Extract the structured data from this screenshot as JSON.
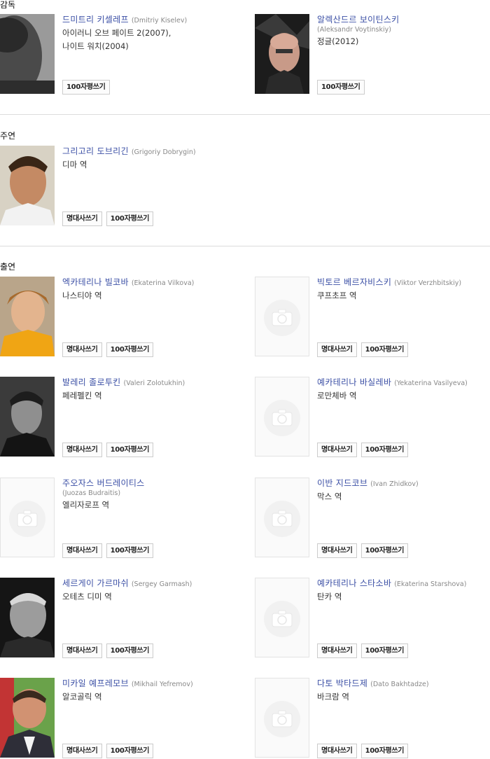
{
  "sections": {
    "director": "감독",
    "lead": "주연",
    "cast": "출연"
  },
  "buttons": {
    "quote": "명대사쓰기",
    "review": "100자평쓰기"
  },
  "directors": [
    {
      "name_ko": "드미트리 키셀레프",
      "name_en": "(Dmitriy Kiselev)",
      "desc": [
        "아이러니 오브 페이트 2(2007),",
        "나이트 워치(2004)"
      ]
    },
    {
      "name_ko": "알렉산드르 보이틴스키",
      "name_en": "(Aleksandr Voytinskiy)",
      "desc": [
        "정글(2012)"
      ]
    }
  ],
  "leads": [
    {
      "name_ko": "그리고리 도브리긴",
      "name_en": "(Grigoriy Dobrygin)",
      "role": "디마 역"
    }
  ],
  "cast": [
    {
      "name_ko": "엑카테리나 빌코바",
      "name_en": "(Ekaterina Vilkova)",
      "role": "나스티야 역"
    },
    {
      "name_ko": "빅토르 베르자비스키",
      "name_en": "(Viktor Verzhbitskiy)",
      "role": "쿠프초프 역"
    },
    {
      "name_ko": "발레리 졸로투킨",
      "name_en": "(Valeri Zolotukhin)",
      "role": "페레펠킨 역"
    },
    {
      "name_ko": "예카테리나 바실레바",
      "name_en": "(Yekaterina Vasilyeva)",
      "role": "로만체바 역"
    },
    {
      "name_ko": "주오자스 버드레이티스",
      "name_en": "(Juozas Budraitis)",
      "role": "엘리자로프 역"
    },
    {
      "name_ko": "이반 지드코브",
      "name_en": "(Ivan Zhidkov)",
      "role": "막스 역"
    },
    {
      "name_ko": "세르게이 가르마쉬",
      "name_en": "(Sergey Garmash)",
      "role": "오테츠 디미 역"
    },
    {
      "name_ko": "예카테리나 스타소바",
      "name_en": "(Ekaterina Starshova)",
      "role": "탄카 역"
    },
    {
      "name_ko": "미카일 예프레모브",
      "name_en": "(Mikhail Yefremov)",
      "role": "알코골릭 역"
    },
    {
      "name_ko": "다토 박타드제",
      "name_en": "(Dato Bakhtadze)",
      "role": "바크람 역"
    }
  ]
}
